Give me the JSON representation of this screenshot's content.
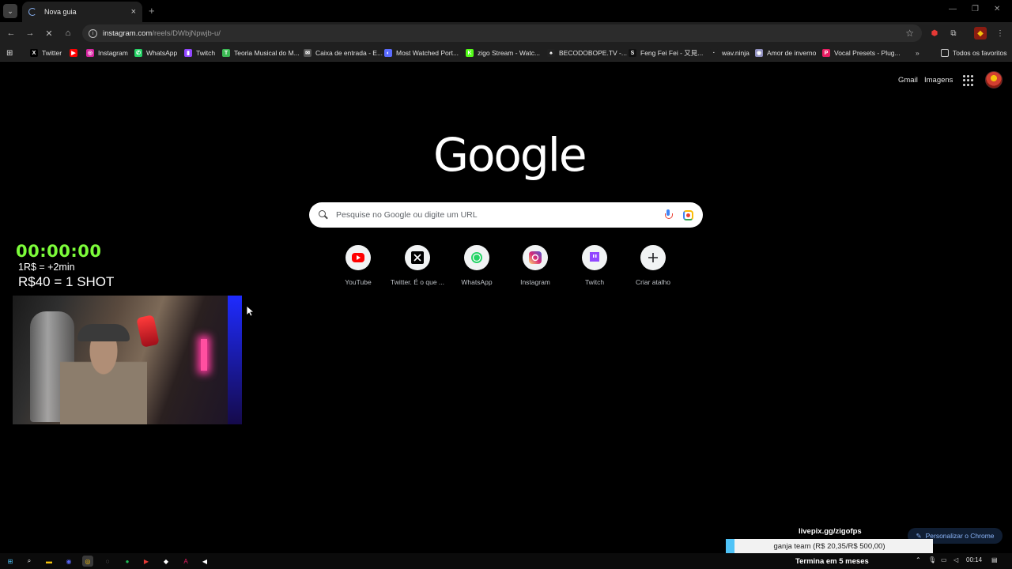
{
  "browser": {
    "tab_title": "Nova guia",
    "tab_close": "×",
    "new_tab": "+",
    "window_controls": [
      "—",
      "❐",
      "✕"
    ],
    "url_host": "instagram.com",
    "url_path": "/reels/DWbjNpwjb-u/",
    "bookmarks": [
      {
        "label": "Twitter",
        "icon": "x-icon",
        "color": "#000000",
        "glyph": "X"
      },
      {
        "label": "",
        "icon": "youtube-icon",
        "color": "#ff0000",
        "glyph": "▶"
      },
      {
        "label": "Instagram",
        "icon": "instagram-icon",
        "color": "#d6249f",
        "glyph": "◎"
      },
      {
        "label": "WhatsApp",
        "icon": "whatsapp-icon",
        "color": "#25d366",
        "glyph": "✆"
      },
      {
        "label": "Twitch",
        "icon": "twitch-icon",
        "color": "#9146ff",
        "glyph": "▮"
      },
      {
        "label": "Teoria Musical do M...",
        "icon": "music-icon",
        "color": "#3cba54",
        "glyph": "T"
      },
      {
        "label": "Caixa de entrada - E...",
        "icon": "mail-icon",
        "color": "#555555",
        "glyph": "✉"
      },
      {
        "label": "Most Watched Port...",
        "icon": "globe-icon",
        "color": "#5a6bff",
        "glyph": "◐"
      },
      {
        "label": "zigo Stream - Watc...",
        "icon": "kick-icon",
        "color": "#53fc18",
        "glyph": "K"
      },
      {
        "label": "BECODOBOPE.TV -...",
        "icon": "becodobope-icon",
        "color": "#222222",
        "glyph": "♠"
      },
      {
        "label": "Feng Fei Fei - 又見...",
        "icon": "s-icon",
        "color": "#111111",
        "glyph": "S"
      },
      {
        "label": "wav.ninja",
        "icon": "ninja-icon",
        "color": "#1f1f1f",
        "glyph": "·"
      },
      {
        "label": "Amor de inverno",
        "icon": "cd-icon",
        "color": "#8f8fbf",
        "glyph": "◉"
      },
      {
        "label": "Vocal Presets - Plug...",
        "icon": "plugin-icon",
        "color": "#e91e63",
        "glyph": "P"
      }
    ],
    "all_bookmarks": "Todos os favoritos",
    "more_bookmarks": "»"
  },
  "ntp": {
    "gmail": "Gmail",
    "images": "Imagens",
    "logo": "Google",
    "search_placeholder": "Pesquise no Google ou digite um URL",
    "shortcuts": [
      {
        "label": "YouTube",
        "icon": "youtube-icon"
      },
      {
        "label": "Twitter. É o que ...",
        "icon": "x-icon"
      },
      {
        "label": "WhatsApp",
        "icon": "whatsapp-icon"
      },
      {
        "label": "Instagram",
        "icon": "instagram-icon"
      },
      {
        "label": "Twitch",
        "icon": "twitch-icon"
      },
      {
        "label": "Criar atalho",
        "icon": "plus-icon"
      }
    ],
    "customize": "Personalizar o Chrome"
  },
  "overlay": {
    "timer": "00:00:00",
    "rate": "1R$ = +2min",
    "shot": "R$40 = 1 SHOT",
    "livepix": "livepix.gg/zigofps",
    "goal_text": "ganja team (R$ 20,35/R$ 500,00)",
    "goal_progress": 0.0407,
    "ends": "Termina em 5 meses"
  },
  "taskbar": {
    "clock": "00:14"
  },
  "colors": {
    "timer_green": "#7cfc3a",
    "goal_fill": "#4fc3f7",
    "link_blue": "#8ab4f8"
  }
}
